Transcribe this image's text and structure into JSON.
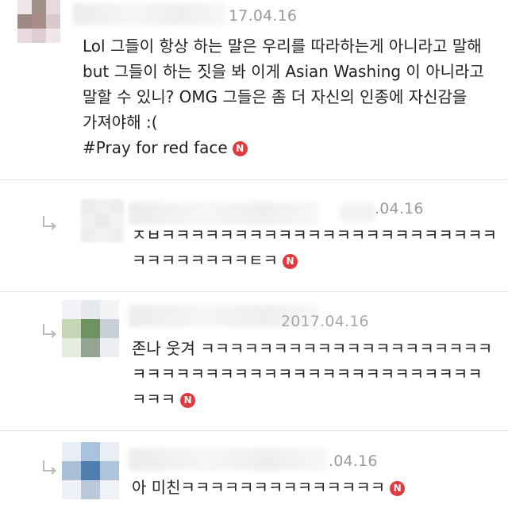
{
  "comments": [
    {
      "date_text": "17.04.16",
      "lines": [
        "Lol 그들이 항상 하는 말은 우리를 따라하는게 아니라고 말해",
        "but 그들이 하는 짓을 봐 이게 Asian Washing 이 아니라고",
        "말할 수 있니? OMG 그들은 좀 더 자신의 인종에 자신감을",
        "가져야해 :(",
        "#Pray for red face"
      ],
      "badge": "N"
    },
    {
      "date_text": ".04.16",
      "lines": [
        "ㅈㅂㅋㅋㅋㅋㅋㅋㅋㅋㅋㅋㅋㅋㅋㅋㅋㅋㅋㅋㅋㅋㅋㅋㅋ",
        "ㅋㅋㅋㅋㅋㅋㅋㅋㅌㅋ"
      ],
      "badge": "N"
    },
    {
      "date_text": "2017.04.16",
      "lines": [
        "존나 웃겨 ㅋㅋㅋㅋㅋㅋㅋㅋㅋㅋㅋㅋㅋㅋㅋㅋㅋㅋㅋㅋ",
        "ㅋㅋㅋㅋㅋㅋㅋㅋㅋㅋㅋㅋㅋㅋㅋㅋㅋㅋㅋㅋㅋㅋㅋㅋ",
        "ㅋㅋㅋ"
      ],
      "badge": "N"
    },
    {
      "date_text": ".04.16",
      "lines": [
        "아 미친ㅋㅋㅋㅋㅋㅋㅋㅋㅋㅋㅋㅋㅋㅋ"
      ],
      "badge": "N"
    }
  ],
  "colors": {
    "badge": "#e0393e",
    "text": "#222222",
    "date": "#9a9a9a",
    "divider": "#e3e3e3"
  },
  "icons": {
    "reply": "reply-arrow-icon",
    "badge": "new-badge-icon"
  }
}
